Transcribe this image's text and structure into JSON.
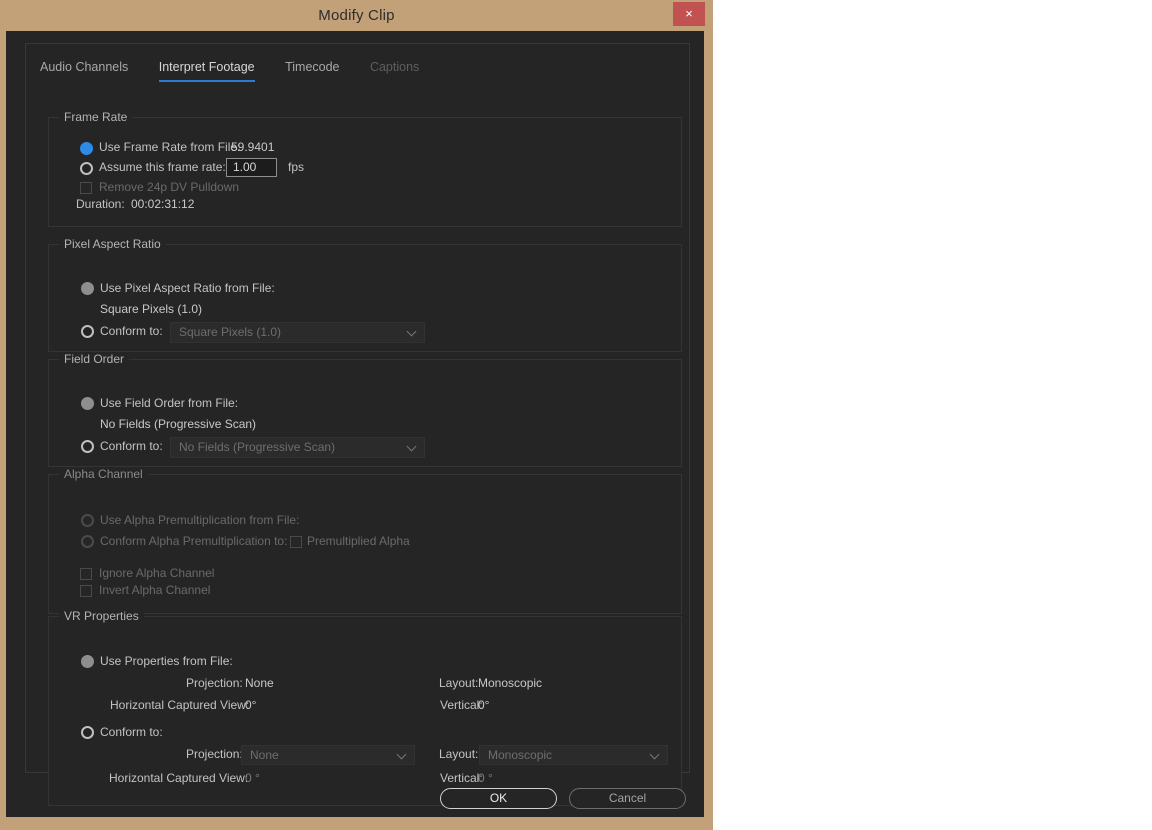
{
  "window": {
    "title": "Modify Clip",
    "close_label": "×"
  },
  "tabs": [
    {
      "label": "Audio Channels",
      "state": "normal"
    },
    {
      "label": "Interpret Footage",
      "state": "active"
    },
    {
      "label": "Timecode",
      "state": "normal"
    },
    {
      "label": "Captions",
      "state": "disabled"
    }
  ],
  "frame_rate": {
    "group_title": "Frame Rate",
    "use_from_file_label": "Use Frame Rate from File:",
    "use_from_file_value": "59.9401",
    "use_from_file_selected": true,
    "assume_label": "Assume this frame rate:",
    "assume_value": "1.00",
    "assume_unit": "fps",
    "pulldown_label": "Remove 24p DV Pulldown",
    "duration_label": "Duration:",
    "duration_value": "00:02:31:12"
  },
  "pixel_aspect_ratio": {
    "group_title": "Pixel Aspect Ratio",
    "use_from_file_label": "Use Pixel Aspect Ratio from File:",
    "use_from_file_value": "Square Pixels (1.0)",
    "conform_label": "Conform to:",
    "conform_value": "Square Pixels (1.0)"
  },
  "field_order": {
    "group_title": "Field Order",
    "use_from_file_label": "Use Field Order from File:",
    "use_from_file_value": "No Fields (Progressive Scan)",
    "conform_label": "Conform to:",
    "conform_value": "No Fields (Progressive Scan)"
  },
  "alpha_channel": {
    "group_title": "Alpha Channel",
    "use_premult_label": "Use Alpha Premultiplication from File:",
    "conform_premult_label": "Conform Alpha Premultiplication to:",
    "premultiplied_label": "Premultiplied Alpha",
    "ignore_label": "Ignore Alpha Channel",
    "invert_label": "Invert Alpha Channel"
  },
  "vr_properties": {
    "group_title": "VR Properties",
    "use_from_file_label": "Use Properties from File:",
    "file_projection_label": "Projection:",
    "file_projection_value": "None",
    "file_layout_label": "Layout:",
    "file_layout_value": "Monoscopic",
    "file_hcv_label": "Horizontal Captured View:",
    "file_hcv_value": "0°",
    "file_vertical_label": "Vertical:",
    "file_vertical_value": "0°",
    "conform_label": "Conform to:",
    "conform_projection_label": "Projection:",
    "conform_projection_value": "None",
    "conform_layout_label": "Layout:",
    "conform_layout_value": "Monoscopic",
    "conform_hcv_label": "Horizontal Captured View:",
    "conform_hcv_value": "0 °",
    "conform_vertical_label": "Vertical:",
    "conform_vertical_value": "0 °"
  },
  "footer": {
    "ok_label": "OK",
    "cancel_label": "Cancel"
  },
  "colors": {
    "window_frame": "#c2a078",
    "dialog_bg": "#252525",
    "accent_blue": "#2e8ae6",
    "close_red": "#c25252"
  }
}
